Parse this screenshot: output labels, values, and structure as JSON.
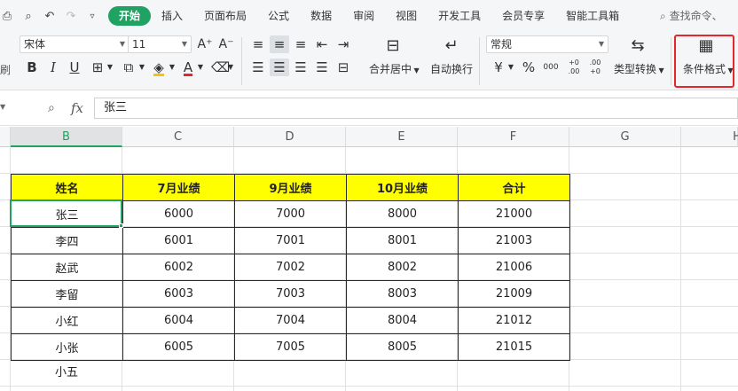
{
  "tabs": {
    "items": [
      "开始",
      "插入",
      "页面布局",
      "公式",
      "数据",
      "审阅",
      "视图",
      "开发工具",
      "会员专享",
      "智能工具箱"
    ],
    "active": "开始",
    "search": "查找命令、"
  },
  "ribbon": {
    "font_name": "宋体",
    "font_size": "11",
    "number_format": "常规",
    "merge_label": "合并居中",
    "wrap_label": "自动换行",
    "convert_label": "类型转换",
    "cond_format_label": "条件格式",
    "percent": "%",
    "thousands": "000",
    "inc_decimal": "+0 .00",
    "dec_decimal": ".00 +0",
    "currency": "¥",
    "bold": "B",
    "italic": "I",
    "underline": "U",
    "font_color_letter": "A",
    "font_grow": "A⁺",
    "font_shrink": "A⁻",
    "left_edge": "刷"
  },
  "formula_bar": {
    "value": "张三",
    "fx": "fx"
  },
  "columns": [
    "B",
    "C",
    "D",
    "E",
    "F",
    "G",
    "H"
  ],
  "active_column": "B",
  "table": {
    "headers": [
      "姓名",
      "7月业绩",
      "9月业绩",
      "10月业绩",
      "合计"
    ],
    "rows": [
      [
        "张三",
        "6000",
        "7000",
        "8000",
        "21000"
      ],
      [
        "李四",
        "6001",
        "7001",
        "8001",
        "21003"
      ],
      [
        "赵武",
        "6002",
        "7002",
        "8002",
        "21006"
      ],
      [
        "李留",
        "6003",
        "7003",
        "8003",
        "21009"
      ],
      [
        "小红",
        "6004",
        "7004",
        "8004",
        "21012"
      ],
      [
        "小张",
        "6005",
        "7005",
        "8005",
        "21015"
      ]
    ],
    "extra_name": "小五"
  },
  "colors": {
    "accent_green": "#1fa262",
    "header_fill": "#ffff00",
    "highlight_red": "#e8262a"
  }
}
